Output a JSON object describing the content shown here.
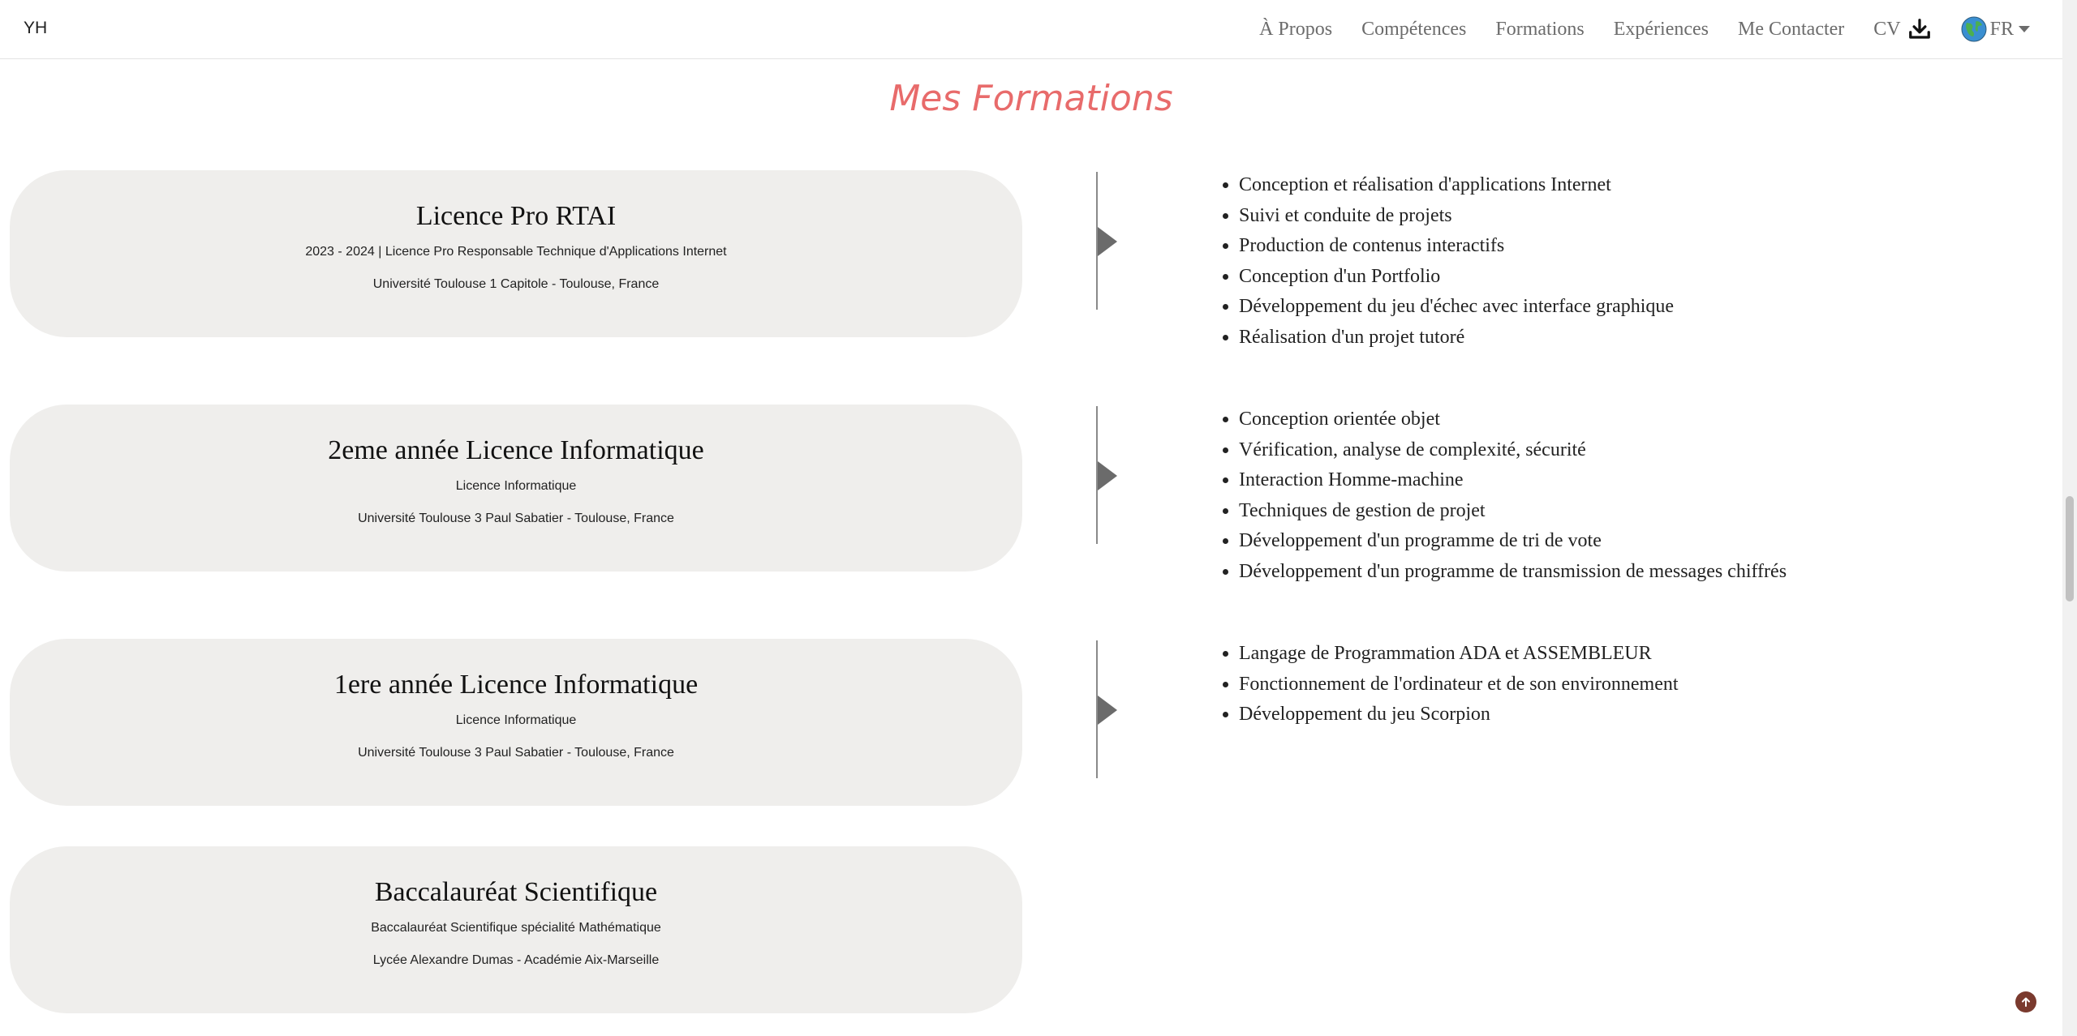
{
  "navbar": {
    "brand": "YH",
    "links": [
      "À Propos",
      "Compétences",
      "Formations",
      "Expériences",
      "Me Contacter"
    ],
    "cv_label": "CV",
    "lang_label": "FR",
    "icons": {
      "download": "download-icon",
      "globe": "globe-icon",
      "caret": "caret-down-icon"
    }
  },
  "section_title": "Mes Formations",
  "colors": {
    "title": "#e86b6b",
    "card_bg": "#efeeec",
    "to_top": "#7a3a2e"
  },
  "formations": [
    {
      "title": "Licence Pro RTAI",
      "subtitle": "2023 - 2024 | Licence Pro Responsable Technique d'Applications Internet",
      "school": "Université Toulouse 1 Capitole - Toulouse, France",
      "details": [
        "Conception et réalisation d'applications Internet",
        "Suivi et conduite de projets",
        "Production de contenus interactifs",
        "Conception d'un Portfolio",
        "Développement du jeu d'échec avec interface graphique",
        "Réalisation d'un projet tutoré"
      ]
    },
    {
      "title": "2eme année Licence Informatique",
      "subtitle": "Licence Informatique",
      "school": "Université Toulouse 3 Paul Sabatier - Toulouse, France",
      "details": [
        "Conception orientée objet",
        "Vérification, analyse de complexité, sécurité",
        "Interaction Homme-machine",
        "Techniques de gestion de projet",
        "Développement d'un programme de tri de vote",
        "Développement d'un programme de transmission de messages chiffrés"
      ]
    },
    {
      "title": "1ere année Licence Informatique",
      "subtitle": "Licence Informatique",
      "school": "Université Toulouse 3 Paul Sabatier - Toulouse, France",
      "details": [
        "Langage de Programmation ADA et ASSEMBLEUR",
        "Fonctionnement de l'ordinateur et de son environnement",
        "Développement du jeu Scorpion"
      ]
    },
    {
      "title": "Baccalauréat Scientifique",
      "subtitle": "Baccalauréat Scientifique spécialité Mathématique",
      "school": "Lycée Alexandre Dumas - Académie Aix-Marseille",
      "details": []
    }
  ]
}
